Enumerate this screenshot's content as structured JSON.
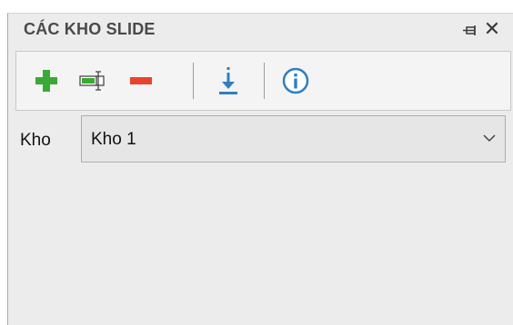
{
  "panel": {
    "title": "CÁC KHO SLIDE",
    "pin_icon": "pin-icon",
    "close_icon": "close-icon",
    "close_glyph": "✕"
  },
  "toolbar": {
    "buttons": [
      {
        "icon": "add-icon",
        "color": "#3aa935"
      },
      {
        "icon": "rename-icon",
        "color": "#3aa935"
      },
      {
        "icon": "remove-icon",
        "color": "#e8432d"
      },
      {
        "icon": "download-icon",
        "color": "#2f7fc1"
      },
      {
        "icon": "info-icon",
        "color": "#2f7fc1"
      }
    ]
  },
  "form": {
    "label": "Kho",
    "select": {
      "value": "Kho 1"
    }
  },
  "colors": {
    "panel_bg": "#ececec",
    "toolbar_bg": "#f4f4f4",
    "add_green": "#3aa935",
    "remove_red": "#e8432d",
    "action_blue": "#2f7fc1"
  }
}
